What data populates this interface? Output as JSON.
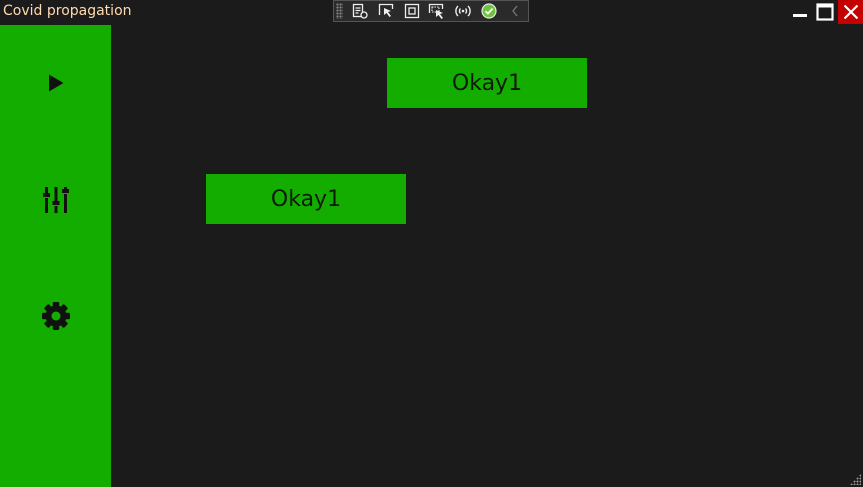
{
  "window": {
    "title": "Covid propagation",
    "controls": {
      "minimize": "minimize-icon",
      "maximize": "maximize-icon",
      "close": "close-icon"
    }
  },
  "dev_toolbar": {
    "tools": [
      "live-visual-tree-icon",
      "select-element-icon",
      "display-layout-adorners-icon",
      "track-focused-element-icon",
      "hot-reload-icon",
      "hot-reload-status-icon",
      "collapse-toolbar-icon"
    ]
  },
  "sidebar": {
    "items": [
      {
        "icon": "play-icon"
      },
      {
        "icon": "sliders-icon"
      },
      {
        "icon": "gear-icon"
      }
    ]
  },
  "main": {
    "buttons": [
      {
        "label": "Okay1"
      },
      {
        "label": "Okay1"
      }
    ]
  },
  "colors": {
    "accent": "#13ad00",
    "background": "#1b1b1b",
    "close": "#c40000",
    "title_text": "#ffdbb0"
  }
}
